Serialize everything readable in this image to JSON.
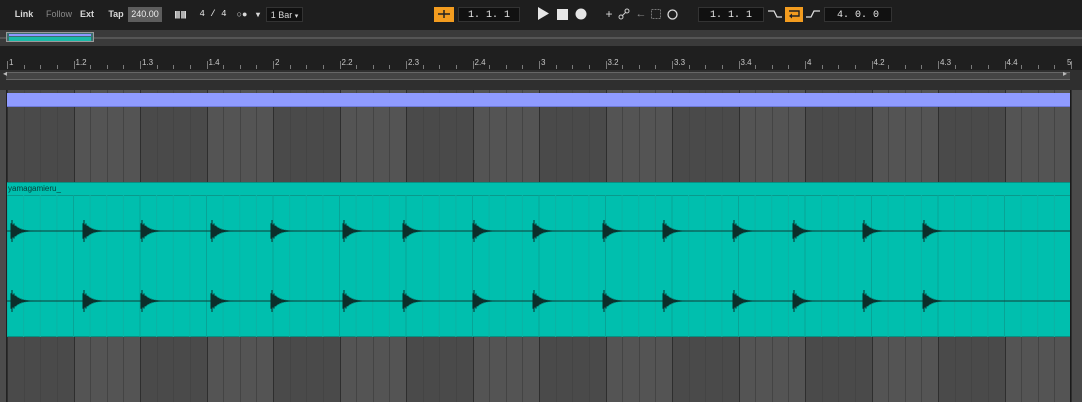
{
  "transport": {
    "link": "Link",
    "follow": "Follow",
    "ext": "Ext",
    "tap": "Tap",
    "tempo": "240.00",
    "meter_icons": "|||| ||||",
    "time_signature": "4 / 4",
    "metronome": "○●",
    "quantization": "1 Bar",
    "arrangement_position": "1.  1.  1",
    "loop_start": "1.  1.  1",
    "loop_length": "4.  0.  0",
    "dropdown_arrow": "▾",
    "colors": {
      "accent": "#f39c1f",
      "clip": "#00bfae",
      "lane": "#8f9bff"
    },
    "icons": [
      "draw-mode-icon",
      "play-icon",
      "stop-icon",
      "record-icon",
      "add-icon",
      "automation-icon",
      "back-icon",
      "punch-icon",
      "circle-icon",
      "punch-in-icon",
      "loop-icon",
      "punch-out-icon"
    ]
  },
  "ruler": {
    "labels": [
      "1",
      "1.2",
      "1.3",
      "1.4",
      "2",
      "2.2",
      "2.3",
      "2.4",
      "3",
      "3.2",
      "3.3",
      "3.4",
      "4",
      "4.2",
      "4.3",
      "4.4",
      "5"
    ]
  },
  "clip": {
    "name": "yamagamieru_"
  }
}
